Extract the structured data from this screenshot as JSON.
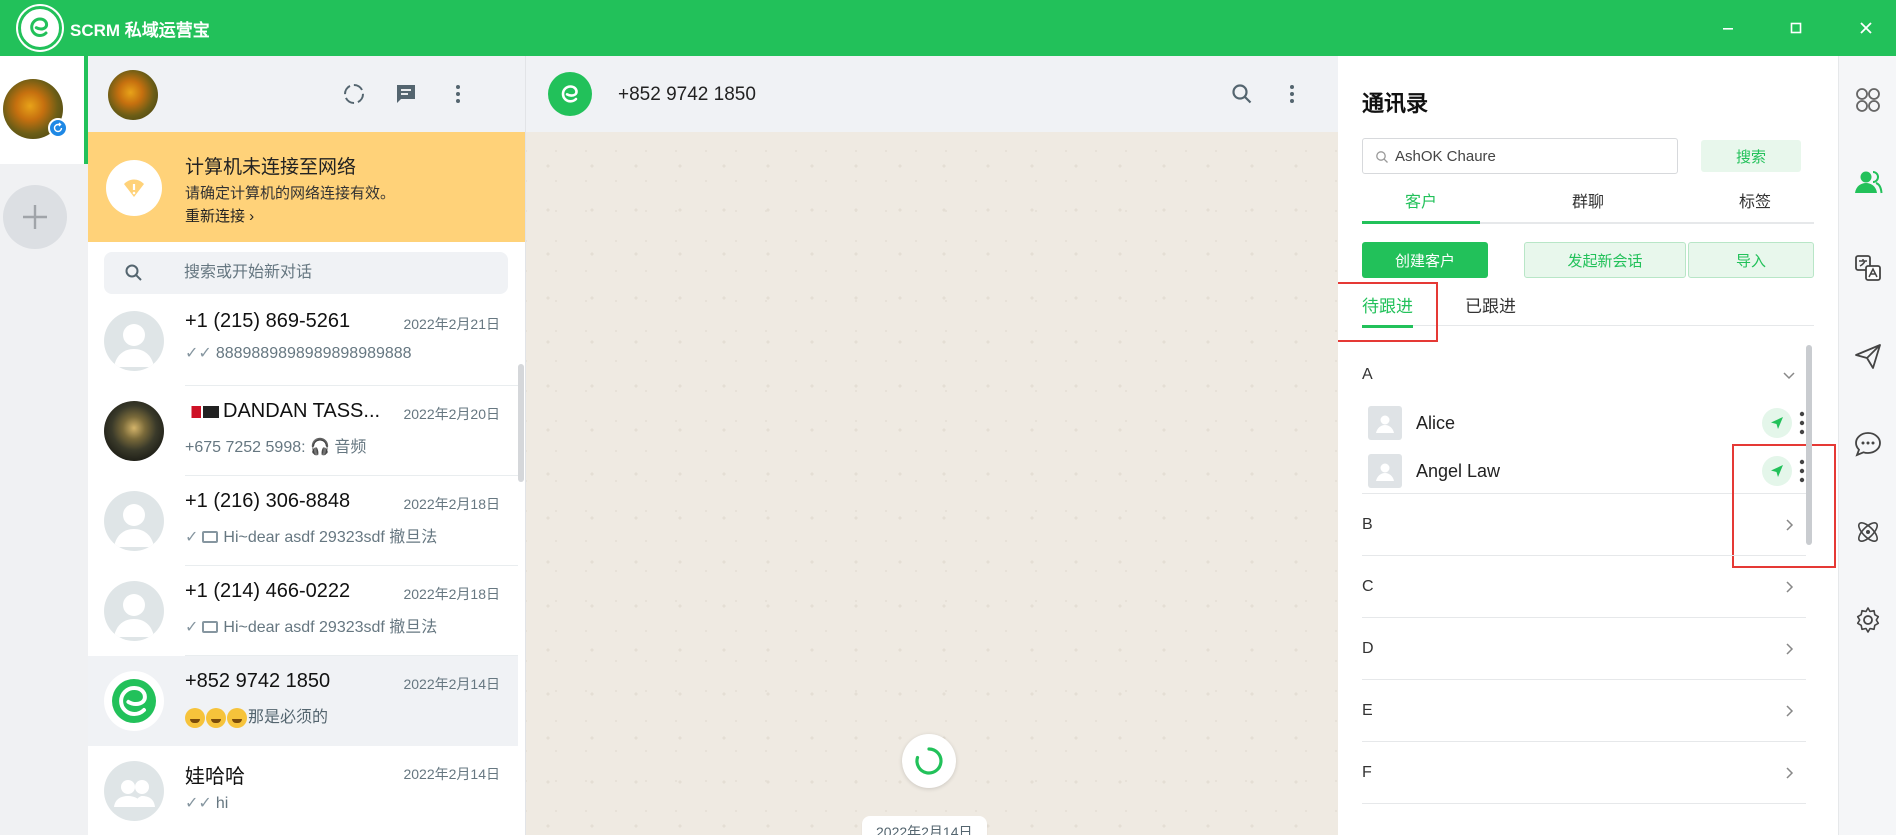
{
  "app": {
    "title": "SCRM 私域运营宝"
  },
  "chat_list": {
    "offline": {
      "title": "计算机未连接至网络",
      "subtitle": "请确定计算机的网络连接有效。",
      "reconnect": "重新连接"
    },
    "search_placeholder": "搜索或开始新对话",
    "chats": [
      {
        "name": "+1 (215) 869-5261",
        "date": "2022年2月21日",
        "tick": "✓✓",
        "message": "8889889898989898989888"
      },
      {
        "name": "DANDAN TASS...",
        "date": "2022年2月20日",
        "tick": "",
        "message": "+675 7252 5998: 🎧 音频"
      },
      {
        "name": "+1 (216) 306-8848",
        "date": "2022年2月18日",
        "tick": "✓",
        "message": "Hi~dear asdf 29323sdf 撤旦法"
      },
      {
        "name": "+1 (214) 466-0222",
        "date": "2022年2月18日",
        "tick": "✓",
        "message": "Hi~dear asdf 29323sdf 撤旦法"
      },
      {
        "name": "+852 9742 1850",
        "date": "2022年2月14日",
        "tick": "",
        "message": "那是必须的"
      },
      {
        "name": "娃哈哈",
        "date": "2022年2月14日",
        "tick": "✓✓",
        "message": "hi"
      }
    ]
  },
  "chat": {
    "contact_name": "+852 9742 1850",
    "date_chip": "2022年2月14日"
  },
  "contacts": {
    "title": "通讯录",
    "search_value": "AshOK Chaure",
    "search_button": "搜索",
    "tabs": [
      "客户",
      "群聊",
      "标签"
    ],
    "buttons": {
      "create": "创建客户",
      "new_chat": "发起新会话",
      "import": "导入"
    },
    "subtabs": [
      "待跟进",
      "已跟进"
    ],
    "groups": [
      {
        "letter": "A",
        "contacts": [
          "Alice",
          "Angel Law"
        ]
      },
      {
        "letter": "B"
      },
      {
        "letter": "C"
      },
      {
        "letter": "D"
      },
      {
        "letter": "E"
      },
      {
        "letter": "F"
      }
    ]
  },
  "colors": {
    "brand": "#22c15a",
    "banner": "#ffd279",
    "highlight": "#e53935"
  },
  "icons": {
    "right_rail": [
      "apps-icon",
      "contacts-icon",
      "translate-icon",
      "send-icon",
      "chat-bubble-icon",
      "atom-icon",
      "settings-icon"
    ]
  }
}
